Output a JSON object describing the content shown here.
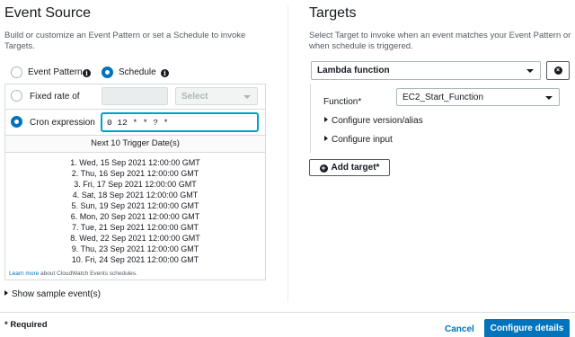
{
  "event_source": {
    "title": "Event Source",
    "description": "Build or customize an Event Pattern or set a Schedule to invoke Targets.",
    "mode_options": [
      {
        "label": "Event Pattern",
        "selected": false
      },
      {
        "label": "Schedule",
        "selected": true
      }
    ],
    "fixed_rate": {
      "label": "Fixed rate of",
      "value": "",
      "unit_placeholder": "Select",
      "selected": false
    },
    "cron": {
      "label": "Cron expression",
      "value": "0 12 * * ? *",
      "selected": true
    },
    "trigger_header": "Next 10 Trigger Date(s)",
    "trigger_dates": [
      "1. Wed, 15 Sep 2021 12:00:00 GMT",
      "2. Thu, 16 Sep 2021 12:00:00 GMT",
      "3. Fri, 17 Sep 2021 12:00:00 GMT",
      "4. Sat, 18 Sep 2021 12:00:00 GMT",
      "5. Sun, 19 Sep 2021 12:00:00 GMT",
      "6. Mon, 20 Sep 2021 12:00:00 GMT",
      "7. Tue, 21 Sep 2021 12:00:00 GMT",
      "8. Wed, 22 Sep 2021 12:00:00 GMT",
      "9. Thu, 23 Sep 2021 12:00:00 GMT",
      "10. Fri, 24 Sep 2021 12:00:00 GMT"
    ],
    "learn_more_link": "Learn more",
    "learn_more_text": " about CloudWatch Events schedules.",
    "show_sample": "Show sample event(s)"
  },
  "targets": {
    "title": "Targets",
    "description": "Select Target to invoke when an event matches your Event Pattern or when schedule is triggered.",
    "target_type": "Lambda function",
    "function_label": "Function*",
    "function_value": "EC2_Start_Function",
    "configure_version": "Configure version/alias",
    "configure_input": "Configure input",
    "add_target": "Add target*"
  },
  "footer": {
    "required_note": "* Required",
    "cancel": "Cancel",
    "configure_details": "Configure details"
  },
  "colors": {
    "accent": "#0073bb",
    "border": "#d5dbdb",
    "text": "#16191f"
  }
}
